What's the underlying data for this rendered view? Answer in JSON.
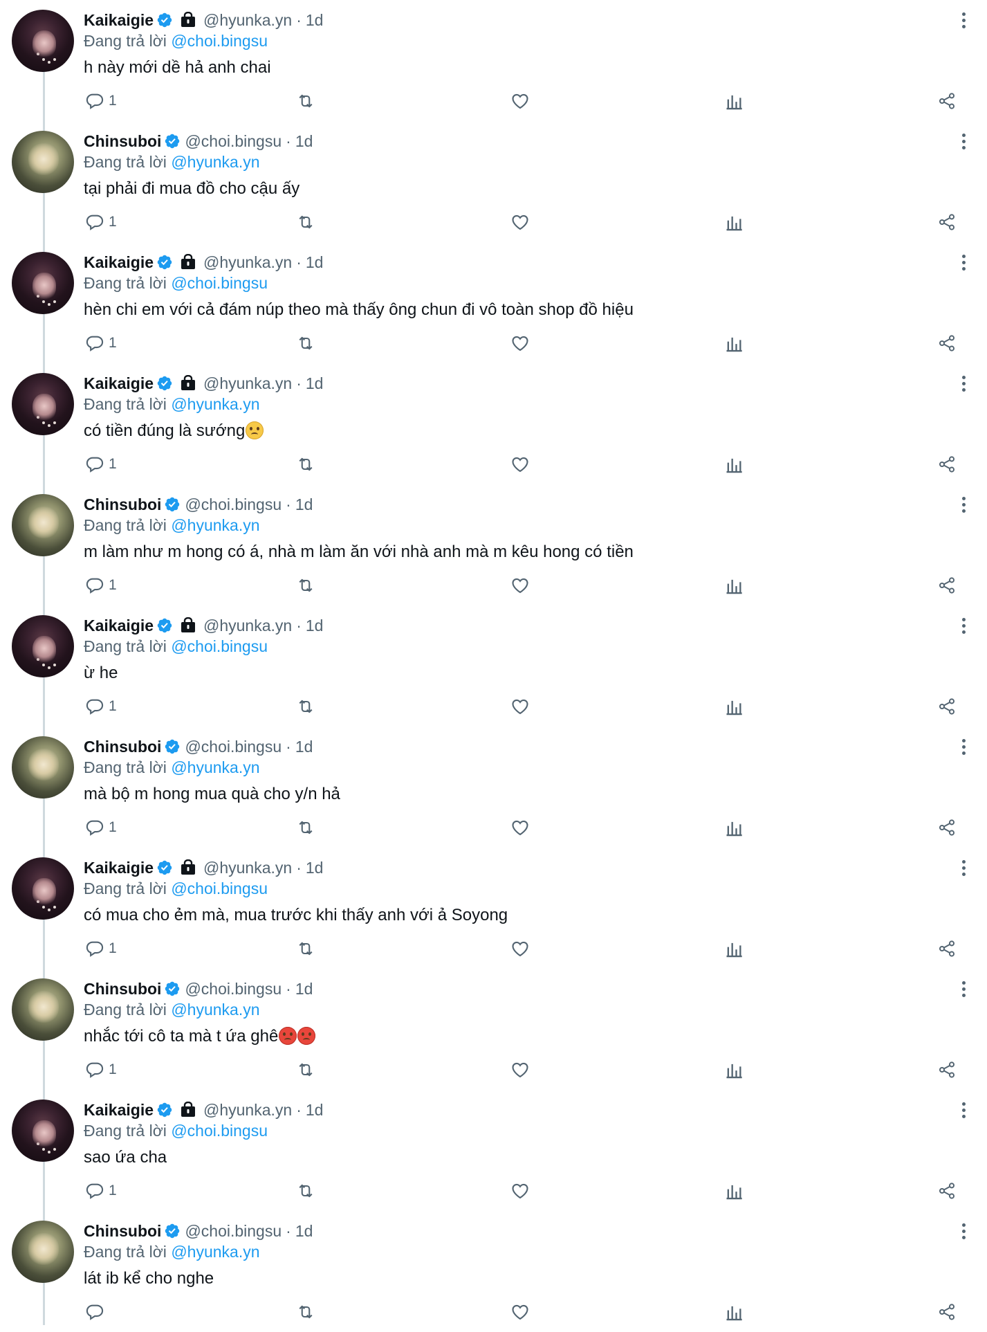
{
  "tweets": [
    {
      "name": "Kaikaigie",
      "handle": "@hyunka.yn",
      "locked": true,
      "time": "1d",
      "replying_label": "Đang trả lời",
      "replying_to": "@choi.bingsu",
      "text": "h này mới dề hả anh chai",
      "reply_count": "1",
      "emoji": []
    },
    {
      "name": "Chinsuboi",
      "handle": "@choi.bingsu",
      "locked": false,
      "time": "1d",
      "replying_label": "Đang trả lời",
      "replying_to": "@hyunka.yn",
      "text": "tại phải đi mua đồ cho cậu ấy",
      "reply_count": "1",
      "emoji": []
    },
    {
      "name": "Kaikaigie",
      "handle": "@hyunka.yn",
      "locked": true,
      "time": "1d",
      "replying_label": "Đang trả lời",
      "replying_to": "@choi.bingsu",
      "text": "hèn chi em với cả đám núp theo mà thấy ông chun đi vô toàn shop đồ hiệu",
      "reply_count": "1",
      "emoji": []
    },
    {
      "name": "Kaikaigie",
      "handle": "@hyunka.yn",
      "locked": true,
      "time": "1d",
      "replying_label": "Đang trả lời",
      "replying_to": "@hyunka.yn",
      "text": "có tiền đúng là sướng",
      "reply_count": "1",
      "emoji": [
        "sad-face-emoji"
      ]
    },
    {
      "name": "Chinsuboi",
      "handle": "@choi.bingsu",
      "locked": false,
      "time": "1d",
      "replying_label": "Đang trả lời",
      "replying_to": "@hyunka.yn",
      "text": "m làm như m hong có á, nhà m làm ăn với nhà anh mà m kêu hong có tiền",
      "reply_count": "1",
      "emoji": []
    },
    {
      "name": "Kaikaigie",
      "handle": "@hyunka.yn",
      "locked": true,
      "time": "1d",
      "replying_label": "Đang trả lời",
      "replying_to": "@choi.bingsu",
      "text": "ừ he",
      "reply_count": "1",
      "emoji": []
    },
    {
      "name": "Chinsuboi",
      "handle": "@choi.bingsu",
      "locked": false,
      "time": "1d",
      "replying_label": "Đang trả lời",
      "replying_to": "@hyunka.yn",
      "text": "mà bộ m hong mua quà cho y/n hả",
      "reply_count": "1",
      "emoji": []
    },
    {
      "name": "Kaikaigie",
      "handle": "@hyunka.yn",
      "locked": true,
      "time": "1d",
      "replying_label": "Đang trả lời",
      "replying_to": "@choi.bingsu",
      "text": "có mua cho ẻm mà, mua trước khi thấy anh với ả Soyong",
      "reply_count": "1",
      "emoji": []
    },
    {
      "name": "Chinsuboi",
      "handle": "@choi.bingsu",
      "locked": false,
      "time": "1d",
      "replying_label": "Đang trả lời",
      "replying_to": "@hyunka.yn",
      "text": "nhắc tới cô ta mà t ứa ghê",
      "reply_count": "1",
      "emoji": [
        "angry-face-emoji",
        "angry-face-emoji"
      ]
    },
    {
      "name": "Kaikaigie",
      "handle": "@hyunka.yn",
      "locked": true,
      "time": "1d",
      "replying_label": "Đang trả lời",
      "replying_to": "@choi.bingsu",
      "text": "sao ứa cha",
      "reply_count": "1",
      "emoji": []
    },
    {
      "name": "Chinsuboi",
      "handle": "@choi.bingsu",
      "locked": false,
      "time": "1d",
      "replying_label": "Đang trả lời",
      "replying_to": "@hyunka.yn",
      "text": "lát ib kể cho nghe",
      "reply_count": "",
      "emoji": []
    }
  ],
  "colors": {
    "accent": "#1d9bf0",
    "muted": "#536471",
    "text": "#0f1419",
    "line": "#cfd9de"
  }
}
